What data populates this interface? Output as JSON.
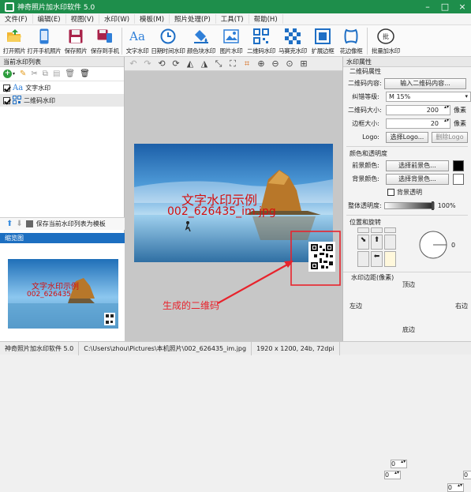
{
  "window": {
    "title": "神奇照片加水印软件 5.0"
  },
  "menu": [
    "文件(F)",
    "编辑(E)",
    "视图(V)",
    "水印(W)",
    "模板(M)",
    "照片处理(P)",
    "工具(T)",
    "帮助(H)"
  ],
  "toolbar": [
    {
      "label": "打开照片",
      "icon": "open-folder-icon"
    },
    {
      "label": "打开手机照片",
      "icon": "phone-icon"
    },
    {
      "label": "保存照片",
      "icon": "save-disk-icon"
    },
    {
      "label": "保存到手机",
      "icon": "save-to-phone-icon"
    },
    {
      "label": "文字水印",
      "icon": "text-aa-icon"
    },
    {
      "label": "日期时间水印",
      "icon": "clock-icon"
    },
    {
      "label": "颜色块水印",
      "icon": "paint-bucket-icon"
    },
    {
      "label": "图片水印",
      "icon": "picture-icon"
    },
    {
      "label": "二维码水印",
      "icon": "qrcode-icon"
    },
    {
      "label": "马赛克水印",
      "icon": "mosaic-icon"
    },
    {
      "label": "扩展边框",
      "icon": "border-expand-icon"
    },
    {
      "label": "花边像框",
      "icon": "lace-frame-icon"
    },
    {
      "label": "批量加水印",
      "icon": "batch-icon"
    }
  ],
  "left": {
    "header": "当前水印列表",
    "items": [
      {
        "label": "文字水印",
        "icon": "text-aa-icon"
      },
      {
        "label": "二维码水印",
        "icon": "qrcode-icon"
      }
    ],
    "save_template": "保存当前水印列表为模板",
    "thumb_header": "缩览图",
    "thumb_text": "文字水印示例",
    "thumb_text2": "002_626435"
  },
  "canvas": {
    "wm_text": "文字水印示例",
    "wm_filename": "002_626435_im.jpg",
    "annotation": "生成的二维码"
  },
  "right": {
    "header": "水印属性",
    "sect_qr": "二维码属性",
    "qr_content_label": "二维码内容:",
    "qr_content_btn": "输入二维码内容...",
    "ecc_label": "纠错等级:",
    "ecc_value": "M 15%",
    "size_label": "二维码大小:",
    "size_value": "200",
    "size_unit": "像素",
    "border_label": "边框大小:",
    "border_value": "20",
    "border_unit": "像素",
    "logo_label": "Logo:",
    "logo_select": "选择Logo...",
    "logo_remove": "删除Logo",
    "sect_color": "颜色和透明度",
    "fg_label": "前景颜色:",
    "fg_btn": "选择前景色...",
    "fg_color": "#000000",
    "bg_label": "背景颜色:",
    "bg_btn": "选择背景色...",
    "bg_color": "#ffffff",
    "bg_transparent": "背景透明",
    "opacity_label": "整体透明度:",
    "opacity_value": "100%",
    "opacity_fraction": 1.0,
    "sect_pos": "位置和旋转",
    "rotation": "0",
    "sect_margin": "水印边距(像素)",
    "top_label": "顶边",
    "left_label": "左边",
    "right_label": "右边",
    "bottom_label": "底边",
    "m_top": "0",
    "m_left": "0",
    "m_right": "0",
    "m_bottom": "0"
  },
  "status": [
    "神奇照片加水印软件 5.0",
    "C:\\Users\\zhou\\Pictures\\本机照片\\002_626435_im.jpg",
    "1920 x 1200, 24b, 72dpi"
  ]
}
